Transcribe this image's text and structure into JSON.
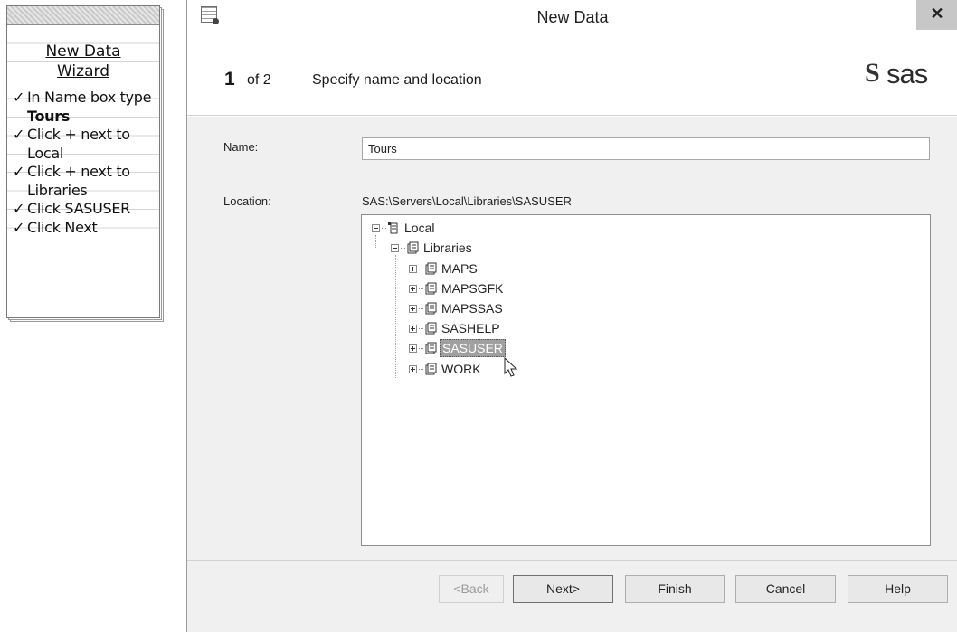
{
  "note": {
    "title_line1": "New Data",
    "title_line2": "Wizard",
    "steps": [
      {
        "check": "✓",
        "text_a": "In Name box type ",
        "bold": "Tours",
        "text_b": ""
      },
      {
        "check": "✓",
        "text_a": "Click + next to Local",
        "bold": "",
        "text_b": ""
      },
      {
        "check": "✓",
        "text_a": "Click + next to Libraries",
        "bold": "",
        "text_b": ""
      },
      {
        "check": "✓",
        "text_a": "Click SASUSER",
        "bold": "",
        "text_b": ""
      },
      {
        "check": "✓",
        "text_a": "Click Next",
        "bold": "",
        "text_b": ""
      }
    ]
  },
  "window": {
    "title": "New Data",
    "close_glyph": "✕",
    "icon": "data-table-icon"
  },
  "header": {
    "step_number": "1",
    "step_of": "of 2",
    "step_title": "Specify name and location",
    "logo_s": "S",
    "logo_text": "sas"
  },
  "form": {
    "name_label": "Name:",
    "name_value": "Tours",
    "location_label": "Location:",
    "location_path": "SAS:\\Servers\\Local\\Libraries\\SASUSER"
  },
  "tree": {
    "root": {
      "label": "Local",
      "expanded": true,
      "icon": "server-icon"
    },
    "libraries": {
      "label": "Libraries",
      "expanded": true,
      "icon": "library-icon"
    },
    "libs": [
      {
        "label": "MAPS",
        "selected": false
      },
      {
        "label": "MAPSGFK",
        "selected": false
      },
      {
        "label": "MAPSSAS",
        "selected": false
      },
      {
        "label": "SASHELP",
        "selected": false
      },
      {
        "label": "SASUSER",
        "selected": true
      },
      {
        "label": "WORK",
        "selected": false
      }
    ]
  },
  "buttons": {
    "back": "<Back",
    "next": "Next>",
    "finish": "Finish",
    "cancel": "Cancel",
    "help": "Help"
  },
  "colors": {
    "titlebar_close_bg": "#c7c7c7",
    "content_bg": "#f0f0f0",
    "selection_bg": "#a0a0a0"
  }
}
